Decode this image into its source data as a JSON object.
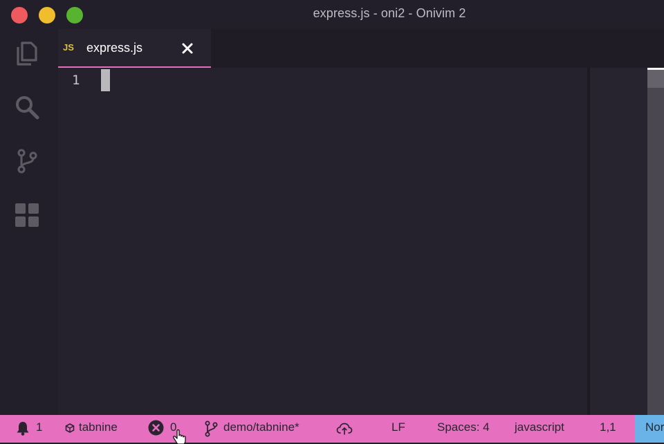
{
  "window": {
    "title": "express.js - oni2 - Onivim 2"
  },
  "activity_bar": {
    "icons": [
      "files-icon",
      "search-icon",
      "source-control-icon",
      "extensions-icon"
    ]
  },
  "tab": {
    "lang_badge": "JS",
    "filename": "express.js"
  },
  "editor": {
    "line_numbers": [
      "1"
    ]
  },
  "statusbar": {
    "notifications_count": "1",
    "tabnine_label": "tabnine",
    "errors_count": "0",
    "branch": "demo/tabnine*",
    "line_ending": "LF",
    "indentation": "Spaces: 4",
    "language": "javascript",
    "position": "1,1",
    "mode": "Normal"
  },
  "colors": {
    "statusbar_bg": "#e66fbf",
    "mode_bg": "#69b3e9",
    "tab_underline": "#e56fbd",
    "js_badge": "#d9c344",
    "editor_bg": "#25212d"
  }
}
